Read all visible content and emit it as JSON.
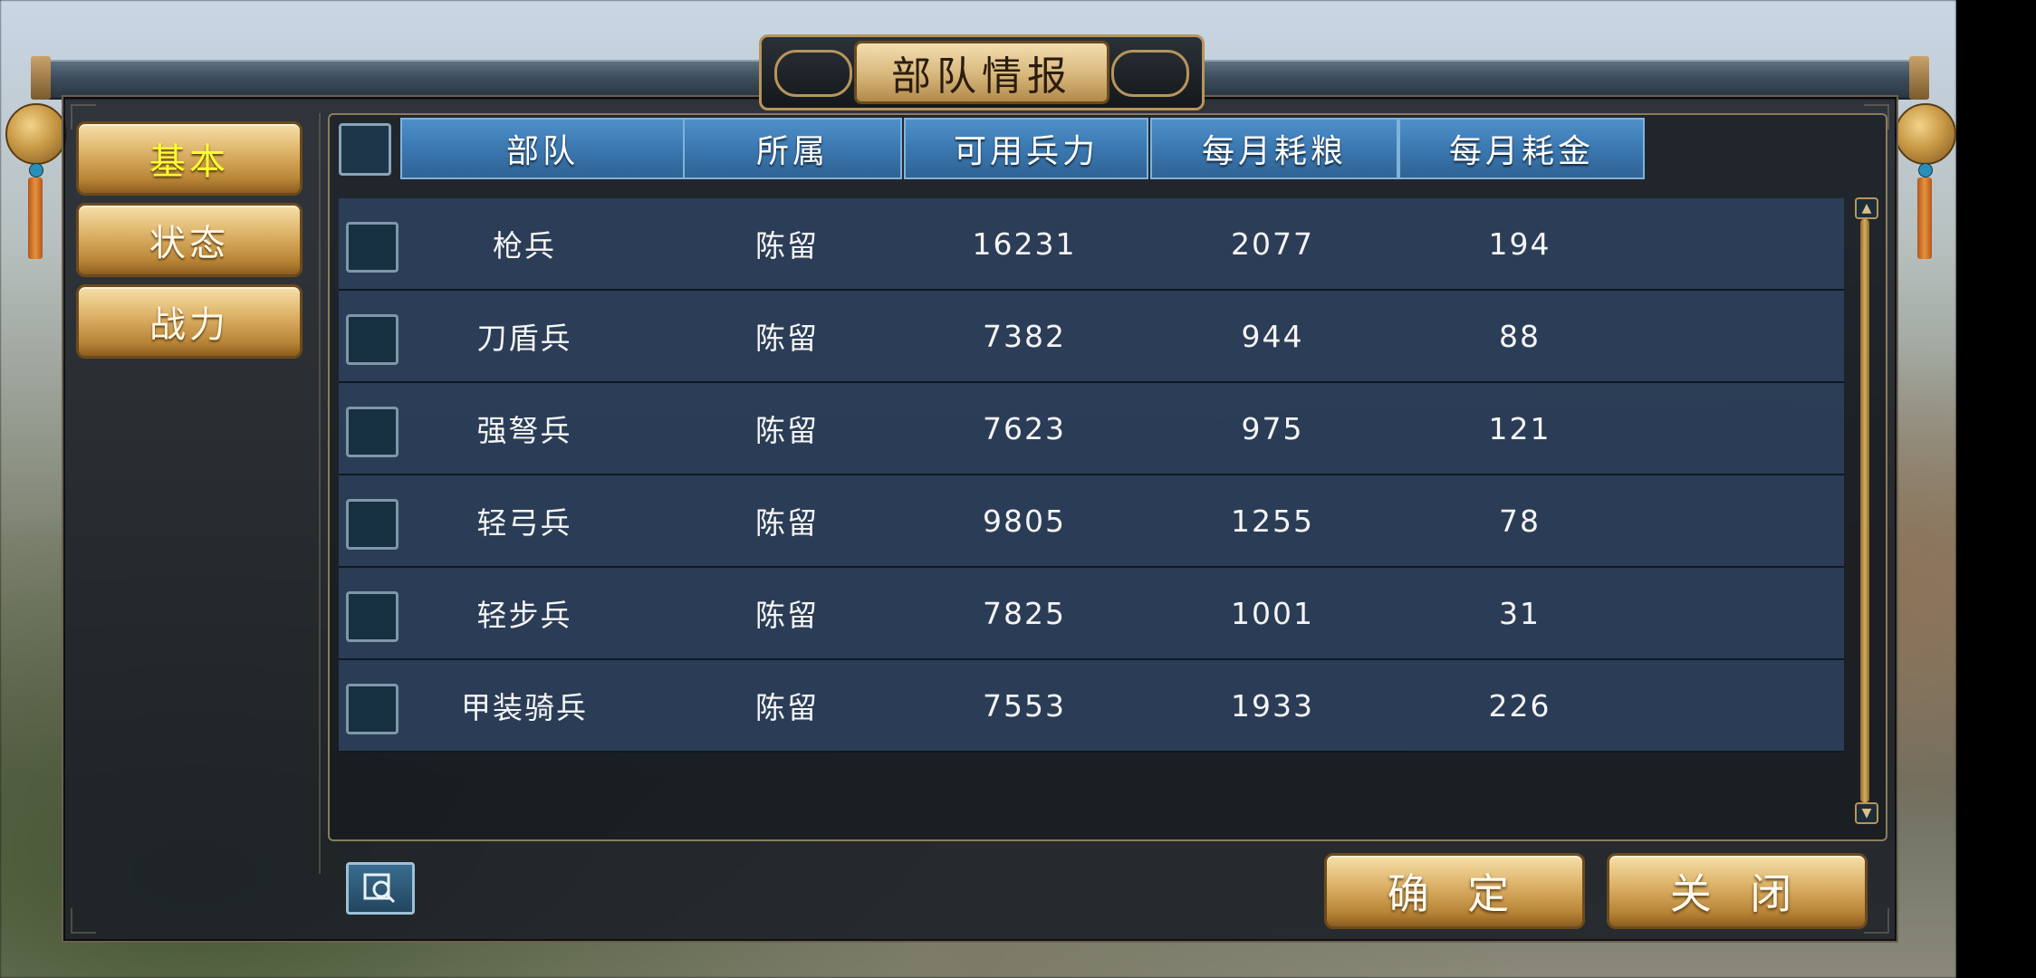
{
  "window": {
    "title": "部队情报"
  },
  "sidebar": {
    "tabs": [
      {
        "label": "基本",
        "active": true
      },
      {
        "label": "状态",
        "active": false
      },
      {
        "label": "战力",
        "active": false
      }
    ]
  },
  "table": {
    "columns": [
      "部队",
      "所属",
      "可用兵力",
      "每月耗粮",
      "每月耗金"
    ],
    "rows": [
      {
        "unit": "枪兵",
        "belongs": "陈留",
        "troops": "16231",
        "food": "2077",
        "gold": "194"
      },
      {
        "unit": "刀盾兵",
        "belongs": "陈留",
        "troops": "7382",
        "food": "944",
        "gold": "88"
      },
      {
        "unit": "强弩兵",
        "belongs": "陈留",
        "troops": "7623",
        "food": "975",
        "gold": "121"
      },
      {
        "unit": "轻弓兵",
        "belongs": "陈留",
        "troops": "9805",
        "food": "1255",
        "gold": "78"
      },
      {
        "unit": "轻步兵",
        "belongs": "陈留",
        "troops": "7825",
        "food": "1001",
        "gold": "31"
      },
      {
        "unit": "甲装骑兵",
        "belongs": "陈留",
        "troops": "7553",
        "food": "1933",
        "gold": "226"
      }
    ]
  },
  "footer": {
    "search_icon": "search-icon",
    "confirm_label": "确 定",
    "close_label": "关 闭"
  },
  "colors": {
    "header_blue": "#3b78b1",
    "row_bg": "#2d405c",
    "gold": "#deb46a",
    "active_tab_text": "#ffff30"
  }
}
